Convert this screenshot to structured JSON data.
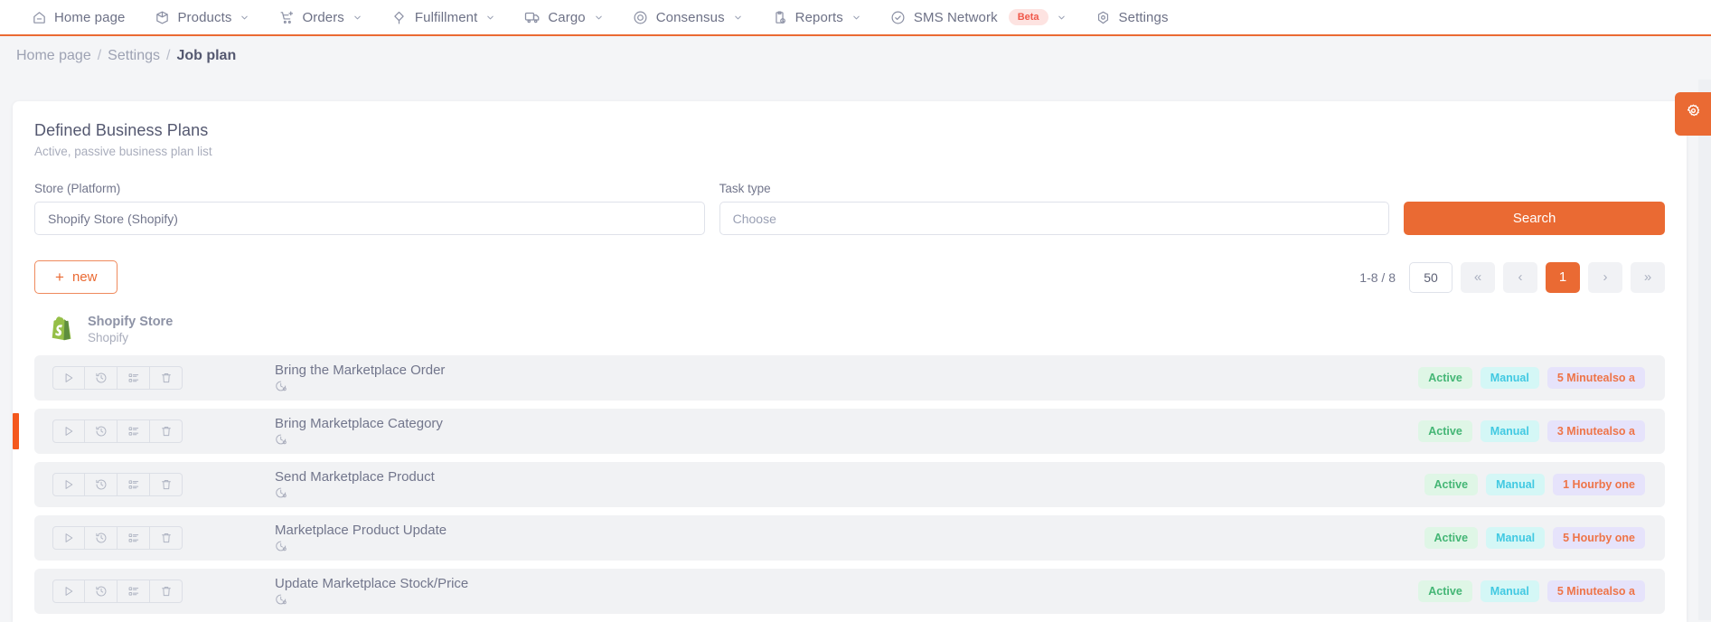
{
  "nav": {
    "items": [
      {
        "label": "Home page",
        "icon": "home-icon",
        "caret": false,
        "badge": null
      },
      {
        "label": "Products",
        "icon": "box-icon",
        "caret": true,
        "badge": null
      },
      {
        "label": "Orders",
        "icon": "cart-plus-icon",
        "caret": true,
        "badge": null
      },
      {
        "label": "Fulfillment",
        "icon": "pin-icon",
        "caret": true,
        "badge": null
      },
      {
        "label": "Cargo",
        "icon": "truck-icon",
        "caret": true,
        "badge": null
      },
      {
        "label": "Consensus",
        "icon": "target-icon",
        "caret": true,
        "badge": null
      },
      {
        "label": "Reports",
        "icon": "clipboard-icon",
        "caret": true,
        "badge": null
      },
      {
        "label": "SMS Network",
        "icon": "check-circle-icon",
        "caret": true,
        "badge": "Beta"
      },
      {
        "label": "Settings",
        "icon": "gear-icon",
        "caret": false,
        "badge": null
      }
    ]
  },
  "breadcrumb": {
    "home": "Home page",
    "settings": "Settings",
    "current": "Job plan",
    "separator": "/"
  },
  "card": {
    "title": "Defined Business Plans",
    "subtitle": "Active, passive business plan list"
  },
  "filters": {
    "store_label": "Store (Platform)",
    "store_value": "Shopify Store (Shopify)",
    "task_label": "Task type",
    "task_placeholder": "Choose",
    "search_label": "Search"
  },
  "toolbar": {
    "new_label": "new",
    "new_plus": "+",
    "range": "1-8 / 8",
    "page_size": "50",
    "first": "«",
    "prev": "‹",
    "page": "1",
    "next": "›",
    "last": "»"
  },
  "store": {
    "name": "Shopify Store",
    "platform": "Shopify",
    "logo": "shopify-logo"
  },
  "rows": [
    {
      "title": "Bring the Marketplace Order",
      "status": "Active",
      "mode": "Manual",
      "interval": "5 Minutealso a",
      "selected": false
    },
    {
      "title": "Bring Marketplace Category",
      "status": "Active",
      "mode": "Manual",
      "interval": "3 Minutealso a",
      "selected": true
    },
    {
      "title": "Send Marketplace Product",
      "status": "Active",
      "mode": "Manual",
      "interval": "1 Hourby one",
      "selected": false
    },
    {
      "title": "Marketplace Product Update",
      "status": "Active",
      "mode": "Manual",
      "interval": "5 Hourby one",
      "selected": false
    },
    {
      "title": "Update Marketplace Stock/Price",
      "status": "Active",
      "mode": "Manual",
      "interval": "5 Minutealso a",
      "selected": false
    }
  ],
  "row_actions": [
    {
      "name": "run-button",
      "icon": "play-icon"
    },
    {
      "name": "history-button",
      "icon": "history-icon"
    },
    {
      "name": "detail-button",
      "icon": "list-icon"
    },
    {
      "name": "delete-button",
      "icon": "trash-icon"
    }
  ],
  "colors": {
    "accent": "#ea6a33",
    "marker": "#f4581d",
    "status_bg": "#dff6e6",
    "status_fg": "#44b675",
    "mode_bg": "#d4f7f6",
    "mode_fg": "#41c9e2",
    "interval_bg": "#e6e3fb",
    "interval_fg": "#ee7448",
    "beta_bg": "#fde3e1",
    "beta_fg": "#f0584a"
  },
  "gear_tab": {
    "icon": "gear-icon"
  }
}
